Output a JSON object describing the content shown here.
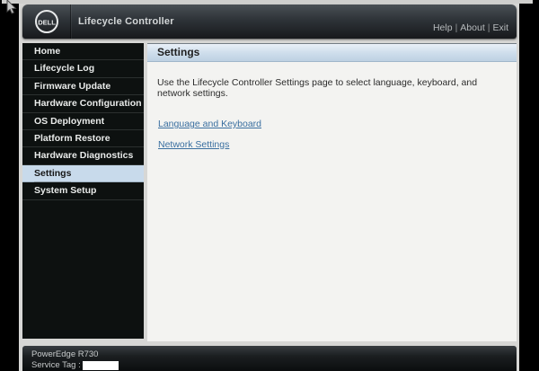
{
  "window": {
    "brand": "DELL",
    "app_title": "Lifecycle Controller",
    "links_divider": "|",
    "top_links": [
      {
        "label": "Help"
      },
      {
        "label": "About"
      },
      {
        "label": "Exit"
      }
    ]
  },
  "sidebar": {
    "items": [
      {
        "label": "Home",
        "selected": false
      },
      {
        "label": "Lifecycle Log",
        "selected": false
      },
      {
        "label": "Firmware Update",
        "selected": false
      },
      {
        "label": "Hardware Configuration",
        "selected": false
      },
      {
        "label": "OS Deployment",
        "selected": false
      },
      {
        "label": "Platform Restore",
        "selected": false
      },
      {
        "label": "Hardware Diagnostics",
        "selected": false
      },
      {
        "label": "Settings",
        "selected": true
      },
      {
        "label": "System Setup",
        "selected": false
      }
    ]
  },
  "main": {
    "title": "Settings",
    "description": "Use the Lifecycle Controller Settings page to select language, keyboard, and network settings.",
    "links": [
      {
        "label": "Language and Keyboard"
      },
      {
        "label": "Network Settings"
      }
    ]
  },
  "footer": {
    "model": "PowerEdge R730",
    "service_tag_label": "Service Tag :",
    "service_tag_redacted": true
  },
  "colors": {
    "topbar_dark": "#2e3338",
    "sidebar_bg": "#0d1110",
    "selected_item_bg": "#c8daeb",
    "header_gradient_bottom": "#bed1e3",
    "link_blue": "#3a6fa0",
    "panel_bg": "#f3f3f1"
  }
}
